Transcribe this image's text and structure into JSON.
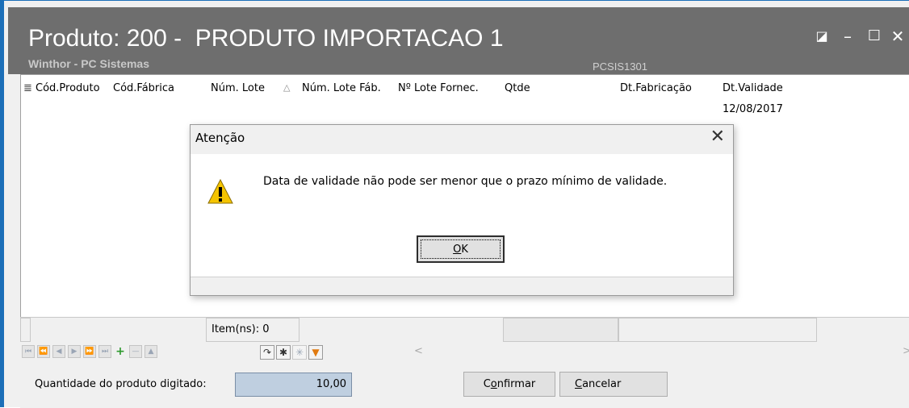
{
  "window": {
    "title": "Produto: 200 -  PRODUTO IMPORTACAO 1",
    "subtitle": "Winthor - PC Sistemas",
    "routine_code": "PCSIS1301",
    "controls": {
      "restore": "◪",
      "minimize": "–",
      "maximize": "☐",
      "close": "✕"
    }
  },
  "grid": {
    "menu_icon": "≣",
    "columns": [
      "Cód.Produto",
      "Cód.Fábrica",
      "Núm. Lote",
      "Núm. Lote Fáb.",
      "Nº Lote Fornec.",
      "Qtde",
      "Dt.Fabricação",
      "Dt.Validade"
    ],
    "sort_indicator": "△",
    "rows": [
      {
        "dt_validade": "12/08/2017"
      }
    ],
    "footer": {
      "items_count": "Item(ns): 0"
    }
  },
  "navigator": {
    "buttons": [
      "⏮",
      "⏪",
      "◀",
      "▶",
      "⏩",
      "⏭",
      "+",
      "—",
      "▲"
    ],
    "tools": [
      "↷",
      "✱",
      "✳",
      "▼"
    ],
    "scroll_left": "<",
    "scroll_right": ">"
  },
  "form": {
    "quantity_label": "Quantidade do produto digitado:",
    "quantity_value": "10,00",
    "confirm_label_pre": "C",
    "confirm_label_ul": "o",
    "confirm_label_post": "nfirmar",
    "cancel_label_ul": "C",
    "cancel_label_post": "ancelar"
  },
  "dialog": {
    "title": "Atenção",
    "close": "✕",
    "message": "Data de validade não pode ser menor que o prazo mínimo de validade.",
    "ok_label_ul": "O",
    "ok_label_post": "K"
  },
  "colors": {
    "titlebar": "#6e6e6e",
    "window_border": "#1c6fb8",
    "field_bg": "#bfcfe0",
    "add_green": "#2e9a2e",
    "filter_orange": "#e07a10"
  }
}
